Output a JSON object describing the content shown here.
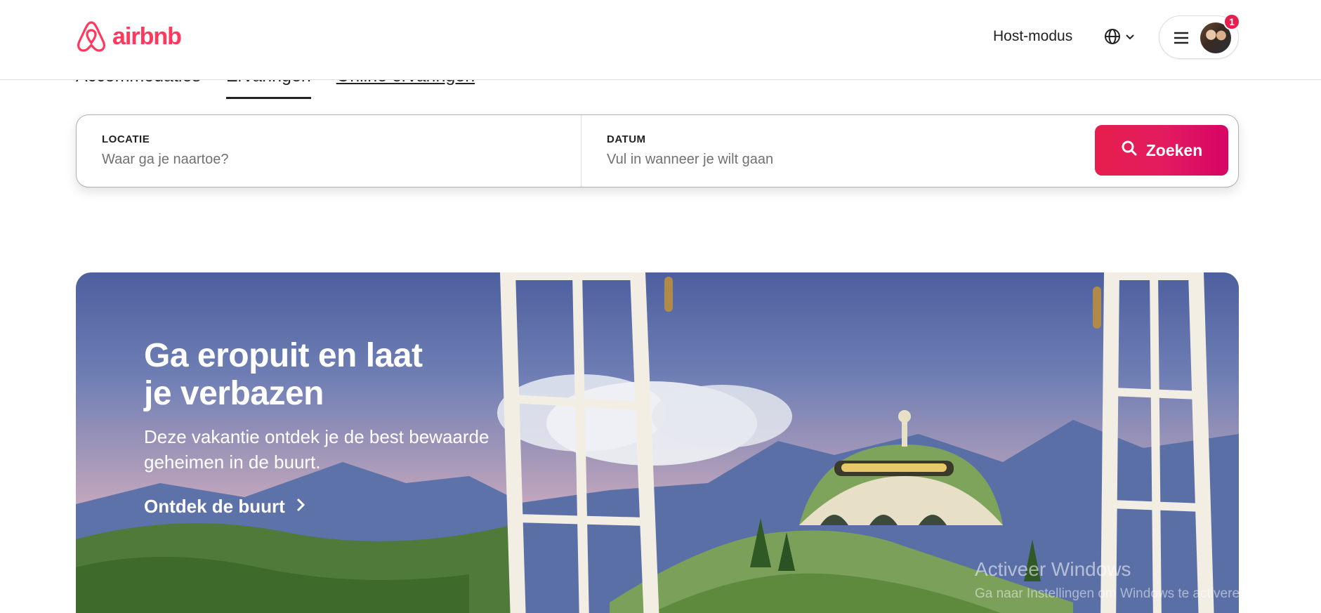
{
  "header": {
    "logo_text": "airbnb",
    "host_link": "Host-modus",
    "notification_count": "1",
    "brand_color": "#ff385c"
  },
  "tabs": [
    {
      "label": "Accommodaties"
    },
    {
      "label": "Ervaringen"
    },
    {
      "label": "Online ervaringen"
    }
  ],
  "search": {
    "location_label": "LOCATIE",
    "location_placeholder": "Waar ga je naartoe?",
    "date_label": "DATUM",
    "date_placeholder": "Vul in wanneer je wilt gaan",
    "button_label": "Zoeken",
    "button_icon": "search-icon"
  },
  "hero": {
    "title_line1": "Ga eropuit en laat",
    "title_line2": "je verbazen",
    "subtitle_line1": "Deze vakantie ontdek je de best bewaarde",
    "subtitle_line2": "geheimen in de buurt.",
    "cta_label": "Ontdek de buurt",
    "cta_icon": "chevron-right-icon"
  },
  "watermark": {
    "title": "Activeer Windows",
    "subtitle": "Ga naar Instellingen om Windows te activeren."
  }
}
